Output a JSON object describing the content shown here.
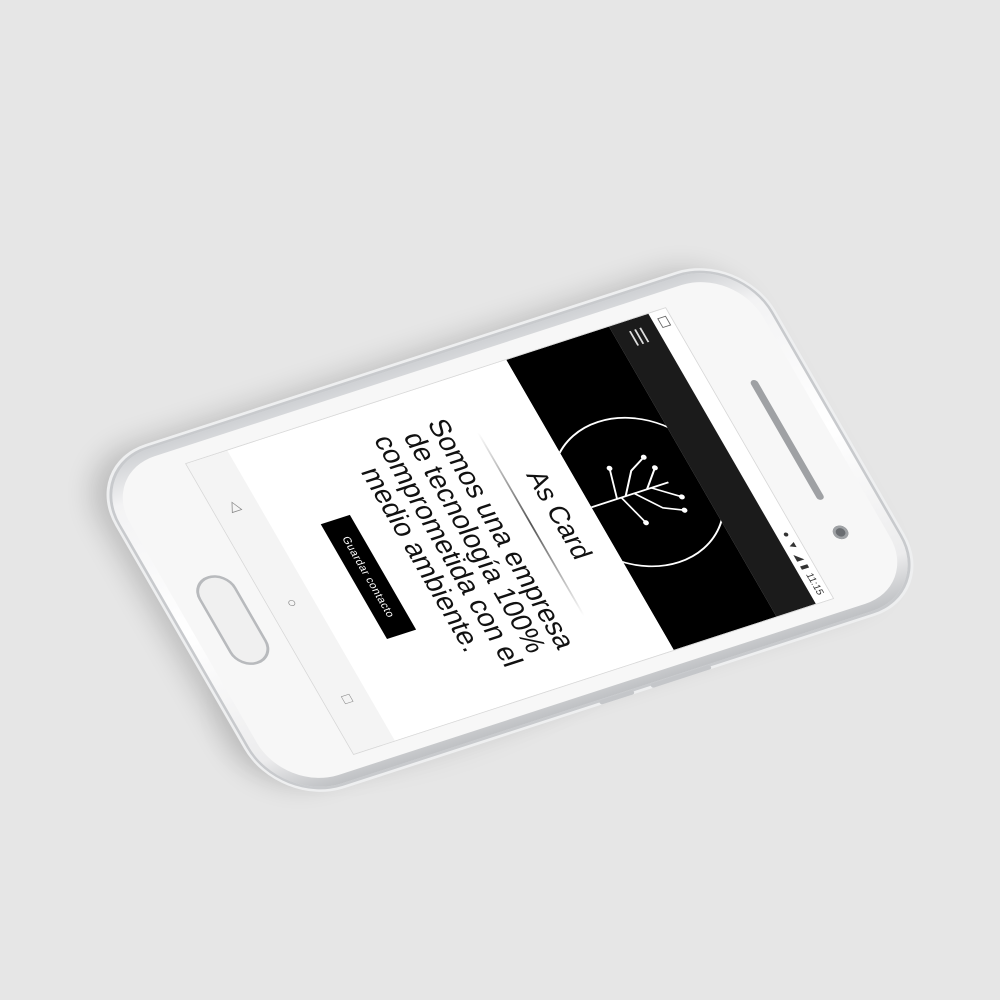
{
  "status_bar": {
    "time": "11:15"
  },
  "app_bar": {
    "menu_icon": "hamburger-menu-icon"
  },
  "hero": {
    "logo_text": "As Card",
    "logo_icon": "circuit-tree-logo"
  },
  "content": {
    "title": "As Card",
    "slogan": "Somos una empresa de tecnología 100% comprometida con el medio ambiente.",
    "button_label": "Guardar contacto"
  },
  "nav_bar": {
    "back_icon": "◁",
    "home_icon": "○",
    "recents_icon": "□"
  },
  "colors": {
    "app_bar": "#1b1b1b",
    "hero_background": "#000000",
    "button": "#000000",
    "page_background": "#e6e6e6"
  }
}
